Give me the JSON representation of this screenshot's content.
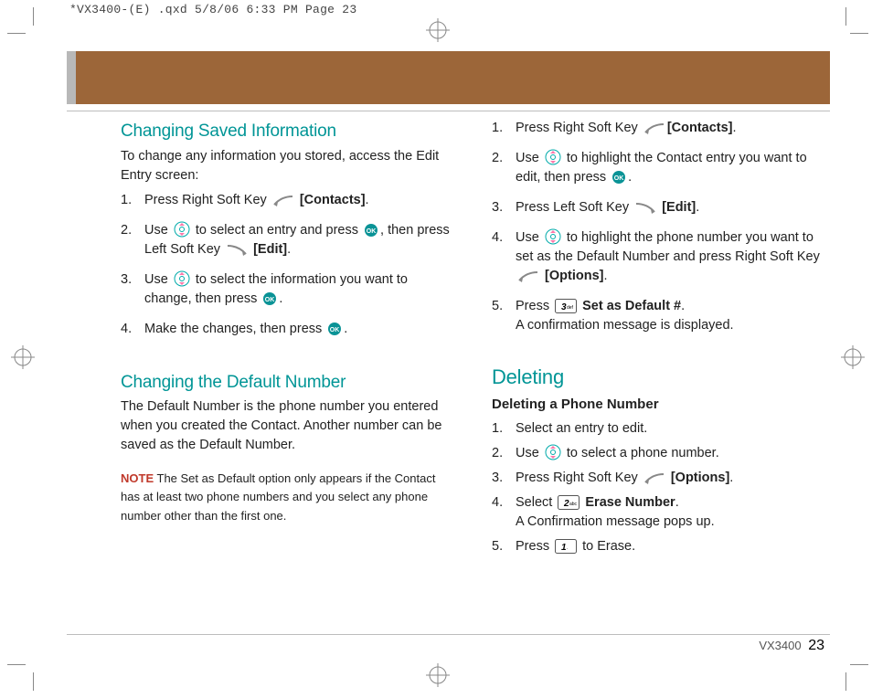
{
  "slug": "*VX3400-(E) .qxd  5/8/06  6:33 PM  Page 23",
  "left": {
    "h1": "Changing Saved Information",
    "intro": "To change any information you stored, access the Edit Entry screen:",
    "steps1": [
      {
        "pre": "Press Right Soft Key ",
        "icon": "softright",
        "post": " ",
        "bold": "[Contacts]",
        "tail": "."
      },
      {
        "pre": "Use ",
        "icon": "nav",
        "mid": " to select an entry and press ",
        "icon2": "ok",
        "mid2": ", then press Left Soft Key ",
        "icon3": "softleft",
        "post": " ",
        "bold": "[Edit]",
        "tail": "."
      },
      {
        "pre": "Use ",
        "icon": "nav",
        "mid": " to select the information you want to change, then press ",
        "icon2": "ok",
        "tail": "."
      },
      {
        "pre": "Make the changes, then press ",
        "icon": "ok",
        "tail": "."
      }
    ],
    "h2": "Changing the Default Number",
    "p2": "The Default Number is the phone number you entered when you created the Contact. Another number can be saved as the Default Number.",
    "note_label": "NOTE",
    "note": " The Set as Default option only appears if the Contact has at least two phone numbers and you select any phone number other than the first one."
  },
  "right": {
    "steps1": [
      {
        "pre": "Press Right Soft Key ",
        "icon": "softright",
        "bold": "[Contacts]",
        "tail": "."
      },
      {
        "pre": "Use ",
        "icon": "nav",
        "mid": " to highlight the Contact entry you want to edit, then press ",
        "icon2": "ok",
        "tail": "."
      },
      {
        "pre": "Press Left Soft Key ",
        "icon": "softleft",
        "post": " ",
        "bold": "[Edit]",
        "tail": "."
      },
      {
        "pre": "Use ",
        "icon": "nav",
        "mid": " to highlight the phone number you want to set as the Default Number and press Right Soft Key ",
        "icon2": "softright",
        "post": " ",
        "bold": "[Options]",
        "tail": "."
      },
      {
        "pre": "Press ",
        "icon": "key3",
        "post": " ",
        "bold": "Set as Default #",
        "tail": ".",
        "extra": "A confirmation message is displayed."
      }
    ],
    "h2": "Deleting",
    "sub": "Deleting a Phone Number",
    "steps2": [
      {
        "pre": "Select an entry to edit."
      },
      {
        "pre": "Use ",
        "icon": "nav",
        "mid": " to select a phone number."
      },
      {
        "pre": "Press Right Soft Key  ",
        "icon": "softright",
        "post": " ",
        "bold": "[Options]",
        "tail": "."
      },
      {
        "pre": "Select ",
        "icon": "key2",
        "post": " ",
        "bold": "Erase Number",
        "tail": ".",
        "extra": "A Confirmation message pops up."
      },
      {
        "pre": "Press ",
        "icon": "key1",
        "mid": " to Erase."
      }
    ]
  },
  "footer": {
    "model": "VX3400",
    "page": "23"
  }
}
